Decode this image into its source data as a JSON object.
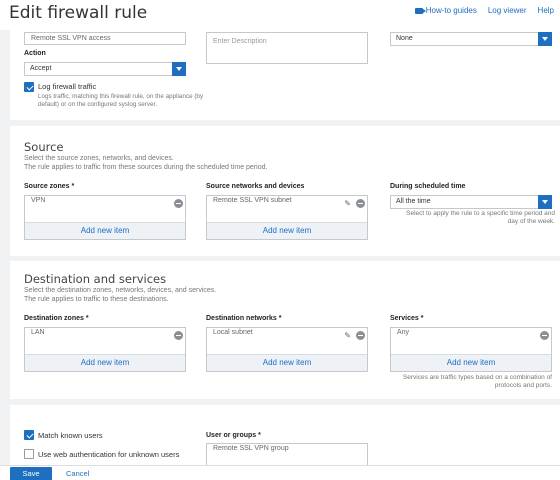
{
  "header": {
    "title": "Edit firewall rule",
    "links": {
      "how_to": "How-to guides",
      "log_viewer": "Log viewer",
      "help": "Help"
    }
  },
  "top": {
    "rule_name": "Remote SSL VPN access",
    "description_placeholder": "Enter Description",
    "right_select": "None",
    "action_label": "Action",
    "action_value": "Accept",
    "log_label": "Log firewall traffic",
    "log_desc_1": "Logs traffic, matching this firewall rule, on the appliance (by",
    "log_desc_2": "default) or on the configured syslog server."
  },
  "source": {
    "title": "Source",
    "desc_1": "Select the source zones, networks, and devices.",
    "desc_2": "The rule applies to traffic from these sources during the scheduled time period.",
    "zones_label": "Source zones",
    "zones_item": "VPN",
    "networks_label": "Source networks and devices",
    "networks_item": "Remote SSL VPN subnet",
    "schedule_label": "During scheduled time",
    "schedule_value": "All the time",
    "schedule_hint_1": "Select to apply the rule to a specific time period and",
    "schedule_hint_2": "day of the week.",
    "add_new": "Add new item"
  },
  "destination": {
    "title": "Destination and services",
    "desc_1": "Select the destination zones, networks, devices, and services.",
    "desc_2": "The rule applies to traffic to these destinations.",
    "zones_label": "Destination zones",
    "zones_item": "LAN",
    "networks_label": "Destination networks",
    "networks_item": "Local subnet",
    "services_label": "Services",
    "services_item": "Any",
    "services_hint_1": "Services are traffic types based on a combination of",
    "services_hint_2": "protocols and ports.",
    "add_new": "Add new item"
  },
  "users": {
    "match_known": "Match known users",
    "web_auth": "Use web authentication for unknown users",
    "groups_label": "User or groups",
    "groups_item": "Remote SSL VPN group"
  },
  "required_mark": "*",
  "footer": {
    "save": "Save",
    "cancel": "Cancel"
  }
}
